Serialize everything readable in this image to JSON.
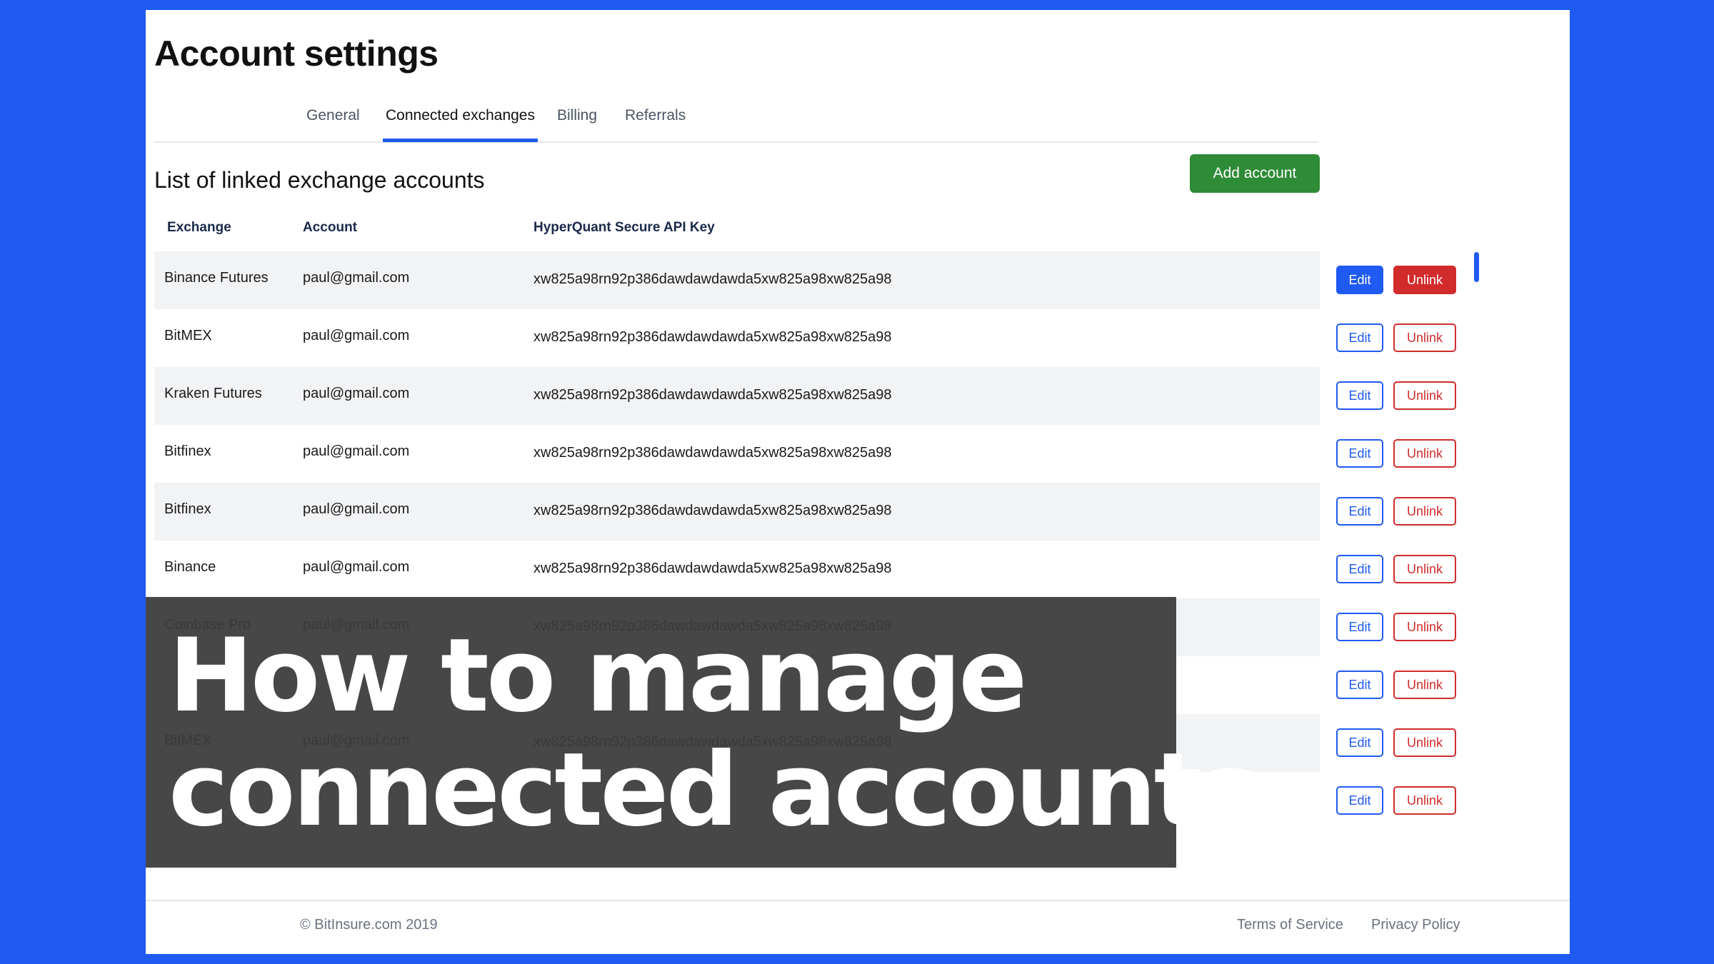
{
  "page": {
    "title": "Account settings"
  },
  "tabs": [
    {
      "label": "General",
      "active": false
    },
    {
      "label": "Connected exchanges",
      "active": true
    },
    {
      "label": "Billing",
      "active": false
    },
    {
      "label": "Referrals",
      "active": false
    }
  ],
  "section": {
    "title": "List of linked exchange accounts",
    "add_button_label": "Add account"
  },
  "table": {
    "headers": {
      "exchange": "Exchange",
      "account": "Account",
      "api_key": "HyperQuant Secure API  Key"
    },
    "edit_label": "Edit",
    "unlink_label": "Unlink",
    "rows": [
      {
        "exchange": "Binance Futures",
        "account": "paul@gmail.com",
        "api_key": "xw825a98rn92p386dawdawdawda5xw825a98xw825a98",
        "highlighted": true
      },
      {
        "exchange": "BitMEX",
        "account": "paul@gmail.com",
        "api_key": "xw825a98rn92p386dawdawdawda5xw825a98xw825a98",
        "highlighted": false
      },
      {
        "exchange": "Kraken Futures",
        "account": "paul@gmail.com",
        "api_key": "xw825a98rn92p386dawdawdawda5xw825a98xw825a98",
        "highlighted": false
      },
      {
        "exchange": "Bitfinex",
        "account": "paul@gmail.com",
        "api_key": "xw825a98rn92p386dawdawdawda5xw825a98xw825a98",
        "highlighted": false
      },
      {
        "exchange": "Bitfinex",
        "account": "paul@gmail.com",
        "api_key": "xw825a98rn92p386dawdawdawda5xw825a98xw825a98",
        "highlighted": false
      },
      {
        "exchange": "Binance",
        "account": "paul@gmail.com",
        "api_key": "xw825a98rn92p386dawdawdawda5xw825a98xw825a98",
        "highlighted": false
      },
      {
        "exchange": "Coinbase Pro",
        "account": "paul@gmail.com",
        "api_key": "xw825a98rn92p386dawdawdawda5xw825a98xw825a98",
        "highlighted": false
      },
      {
        "exchange": "",
        "account": "",
        "api_key": "",
        "highlighted": false
      },
      {
        "exchange": "BitMEX",
        "account": "paul@gmail.com",
        "api_key": "xw825a98rn92p386dawdawdawda5xw825a98xw825a98",
        "highlighted": false
      },
      {
        "exchange": "",
        "account": "",
        "api_key": "",
        "highlighted": false
      }
    ]
  },
  "overlay": {
    "line1": "How to manage",
    "line2": "connected accounts"
  },
  "footer": {
    "copyright": "© BitInsure.com 2019",
    "terms_label": "Terms of Service",
    "privacy_label": "Privacy Policy"
  },
  "colors": {
    "background": "#1f5af2",
    "accent_blue": "#1f5af2",
    "danger_red": "#d12b2b",
    "success_green": "#2e8b36"
  }
}
